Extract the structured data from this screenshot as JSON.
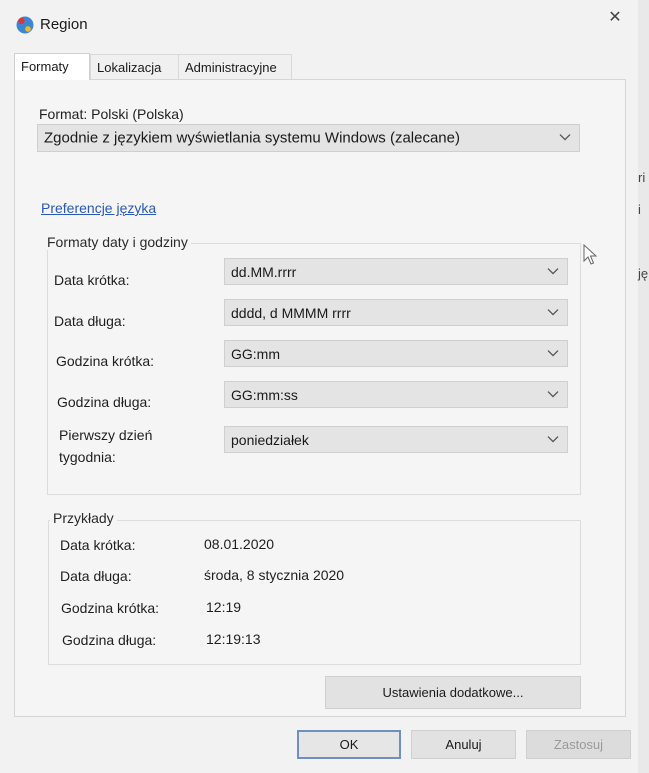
{
  "window": {
    "title": "Region",
    "close_glyph": "✕"
  },
  "tabs": [
    {
      "label": "Formaty",
      "active": true
    },
    {
      "label": "Lokalizacja",
      "active": false
    },
    {
      "label": "Administracyjne",
      "active": false
    }
  ],
  "format": {
    "label": "Format: Polski (Polska)",
    "selected": "Zgodnie z językiem wyświetlania systemu Windows (zalecane)"
  },
  "language_prefs_link": "Preferencje języka",
  "date_time_formats": {
    "title": "Formaty daty i godziny",
    "rows": [
      {
        "label": "Data krótka:",
        "value": "dd.MM.rrrr"
      },
      {
        "label": "Data długa:",
        "value": "dddd, d MMMM rrrr"
      },
      {
        "label": "Godzina krótka:",
        "value": "GG:mm"
      },
      {
        "label": "Godzina długa:",
        "value": "GG:mm:ss"
      },
      {
        "label_line1": "Pierwszy dzień",
        "label_line2": "tygodnia:",
        "value": "poniedziałek"
      }
    ]
  },
  "examples": {
    "title": "Przykłady",
    "rows": [
      {
        "label": "Data krótka:",
        "value": "08.01.2020"
      },
      {
        "label": "Data długa:",
        "value": "środa, 8 stycznia 2020"
      },
      {
        "label": "Godzina krótka:",
        "value": "12:19"
      },
      {
        "label": "Godzina długa:",
        "value": "12:19:13"
      }
    ]
  },
  "buttons": {
    "additional_settings": "Ustawienia dodatkowe...",
    "ok": "OK",
    "cancel": "Anuluj",
    "apply": "Zastosuj"
  },
  "background_edge_chars": [
    "ri",
    "i",
    "ję"
  ],
  "colors": {
    "link": "#2a58b8",
    "default_button_border": "#6f8fc0"
  },
  "icons": {
    "app": "region-globe-icon",
    "dropdown": "chevron-down-icon",
    "cursor": "mouse-pointer-icon"
  }
}
